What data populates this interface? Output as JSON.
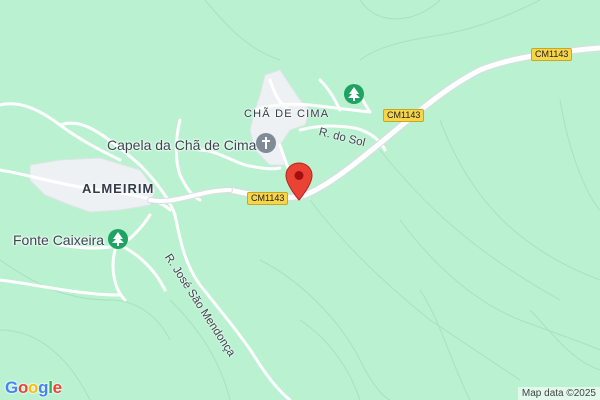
{
  "map": {
    "places": {
      "almeirim": "ALMEIRIM",
      "cha_de_cima": "CHÃ DE CIMA"
    },
    "pois": {
      "capela": "Capela da Chã de Cima",
      "fonte": "Fonte Caixeira"
    },
    "streets": {
      "rua_do_sol": "R. do Sol",
      "rua_jose": "R. José São Mendonça"
    },
    "road_shields": {
      "shield_1": "CM1143",
      "shield_2": "CM1143",
      "shield_3": "CM1143"
    },
    "logo": {
      "g1": "G",
      "o1": "o",
      "o2": "o",
      "g2": "g",
      "l": "l",
      "e": "e"
    },
    "attribution": "Map data ©2025",
    "colors": {
      "land": "#baf1d0",
      "road": "#ffffff",
      "built_area": "#eef1f3",
      "marker": "#ea4335",
      "park_icon": "#1ea362",
      "place_of_worship_icon": "#7f8c98",
      "road_shield": "#f7d54a"
    },
    "icons": [
      "location-pin-icon",
      "tree-icon",
      "church-icon"
    ]
  }
}
